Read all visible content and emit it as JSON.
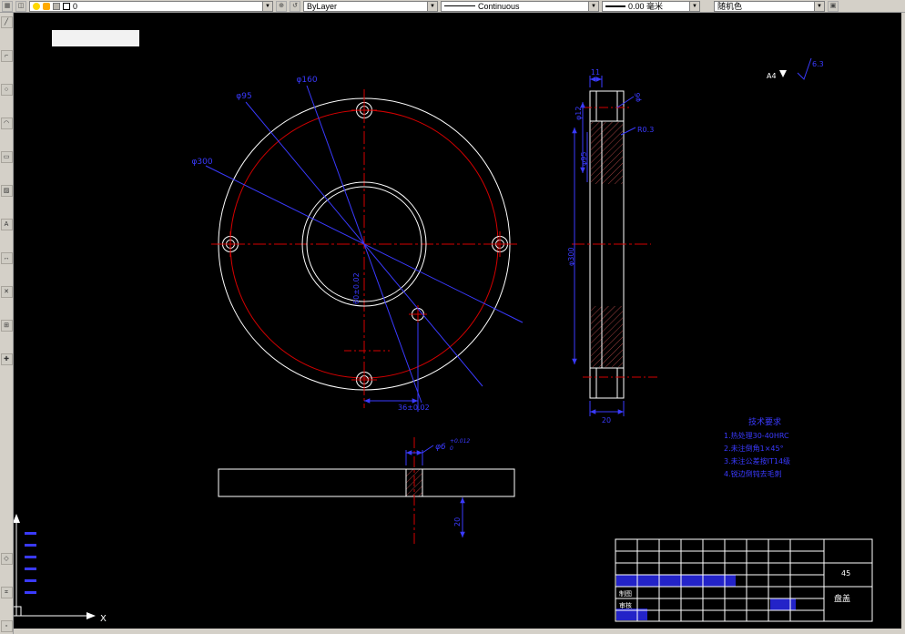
{
  "toolbar": {
    "layer_value": "0",
    "color_value": "ByLayer",
    "linetype_value": "Continuous",
    "lineweight_value": "0.00 毫米",
    "plotstyle_value": "随机色"
  },
  "canvas": {
    "front_view": {
      "dim1": "φ95",
      "dim2": "φ160",
      "dim3": "φ300",
      "dim_bore": "60±0.02",
      "dim_offset": "36±0.02"
    },
    "side_view": {
      "dim_hub": "11",
      "dim_d1": "φ12",
      "dim_d2": "φ95",
      "dim_d3": "φ300",
      "dim_hole": "φ6",
      "fillet": "R0.3",
      "dim_thickness": "20"
    },
    "section_view": {
      "dim_hole": "φ6",
      "tol_upper": "+0.012",
      "tol_lower": "0",
      "dim_depth": "20"
    },
    "notes": {
      "title": "技术要求",
      "line1": "1.热处理30-40HRC",
      "line2": "2.未注倒角1×45°",
      "line3": "3.未注公差按IT14级",
      "line4": "4.锐边倒钝去毛刺"
    },
    "sheet": {
      "size": "A4",
      "roughness": "6.3"
    },
    "ucs": {
      "x_label": "X"
    },
    "title_block": {
      "cell1": "制图",
      "cell2": "审核",
      "material": "45",
      "part_name": "盘盖"
    }
  }
}
